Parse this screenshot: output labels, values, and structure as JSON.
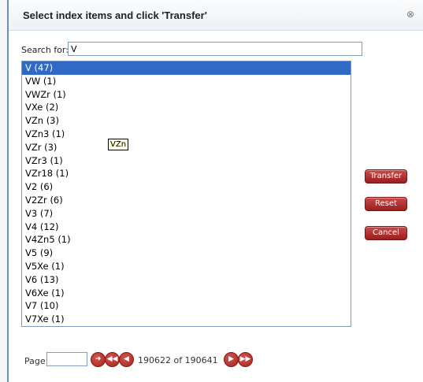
{
  "dialog": {
    "title": "Select index items and click 'Transfer'",
    "close_glyph": "⊗"
  },
  "search": {
    "label": "Search for:",
    "value": "V"
  },
  "list": {
    "items": [
      "V (47)",
      "VW (1)",
      "VWZr (1)",
      "VXe (2)",
      "VZn (3)",
      "VZn3 (1)",
      "VZr (3)",
      "VZr3 (1)",
      "VZr18 (1)",
      "V2 (6)",
      "V2Zr (6)",
      "V3 (7)",
      "V4 (12)",
      "V4Zn5 (1)",
      "V5 (9)",
      "V5Xe (1)",
      "V6 (13)",
      "V6Xe (1)",
      "V7 (10)",
      "V7Xe (1)"
    ],
    "selected_index": 0
  },
  "tooltip": {
    "text": "VZn"
  },
  "buttons": {
    "transfer": "Transfer",
    "reset": "Reset",
    "cancel": "Cancel"
  },
  "pager": {
    "label": "Page",
    "input_value": "",
    "status": "190622 of 190641",
    "icons": {
      "go": "arrow-right-circle-icon",
      "first": "first-page-icon",
      "prev": "previous-page-icon",
      "next": "next-page-icon",
      "last": "last-page-icon"
    }
  },
  "colors": {
    "accent": "#316ac5",
    "button": "#b0302b",
    "border": "#7f9db9"
  }
}
